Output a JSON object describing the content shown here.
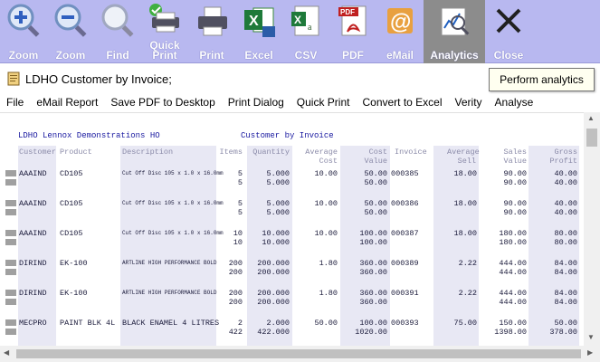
{
  "toolbar": {
    "buttons": [
      {
        "label": "Zoom",
        "icon": "zoom-in-icon"
      },
      {
        "label": "Zoom",
        "icon": "zoom-out-icon"
      },
      {
        "label": "Find",
        "icon": "find-icon"
      },
      {
        "label": "Quick Print",
        "icon": "quick-print-icon"
      },
      {
        "label": "Print",
        "icon": "print-icon"
      },
      {
        "label": "Excel",
        "icon": "excel-icon"
      },
      {
        "label": "CSV",
        "icon": "csv-icon"
      },
      {
        "label": "PDF",
        "icon": "pdf-icon"
      },
      {
        "label": "eMail",
        "icon": "email-icon"
      },
      {
        "label": "Analytics",
        "icon": "analytics-icon"
      },
      {
        "label": "Close",
        "icon": "close-icon"
      }
    ],
    "active": "Analytics"
  },
  "window": {
    "title": "LDHO Customer by Invoice;"
  },
  "tooltip": "Perform analytics",
  "menu": [
    "File",
    "eMail Report",
    "Save PDF to Desktop",
    "Print Dialog",
    "Quick Print",
    "Convert to Excel",
    "Verity",
    "Analyse"
  ],
  "report": {
    "company": "LDHO Lennox Demonstrations HO",
    "name": "Customer by Invoice",
    "columns": [
      "Customer",
      "Product",
      "Description",
      "Items",
      "Quantity",
      "Average Cost",
      "Cost Value",
      "Invoice",
      "Average Sell",
      "Sales Value",
      "Gross Profit"
    ],
    "rows": [
      {
        "customer": "AAAIND",
        "product": "CD105",
        "description": "Cut Off Disc 105 x 1.0 x 16.0mm",
        "items": [
          "5",
          "5"
        ],
        "quantity": [
          "5.000",
          "5.000"
        ],
        "avg_cost": "10.00",
        "cost_value": [
          "50.00",
          "50.00"
        ],
        "invoice": "000385",
        "avg_sell": "18.00",
        "sales_value": [
          "90.00",
          "90.00"
        ],
        "gross_profit": [
          "40.00",
          "40.00"
        ]
      },
      {
        "customer": "AAAIND",
        "product": "CD105",
        "description": "Cut Off Disc 105 x 1.0 x 16.0mm",
        "items": [
          "5",
          "5"
        ],
        "quantity": [
          "5.000",
          "5.000"
        ],
        "avg_cost": "10.00",
        "cost_value": [
          "50.00",
          "50.00"
        ],
        "invoice": "000386",
        "avg_sell": "18.00",
        "sales_value": [
          "90.00",
          "90.00"
        ],
        "gross_profit": [
          "40.00",
          "40.00"
        ]
      },
      {
        "customer": "AAAIND",
        "product": "CD105",
        "description": "Cut Off Disc 105 x 1.0 x 16.0mm",
        "items": [
          "10",
          "10"
        ],
        "quantity": [
          "10.000",
          "10.000"
        ],
        "avg_cost": "10.00",
        "cost_value": [
          "100.00",
          "100.00"
        ],
        "invoice": "000387",
        "avg_sell": "18.00",
        "sales_value": [
          "180.00",
          "180.00"
        ],
        "gross_profit": [
          "80.00",
          "80.00"
        ]
      },
      {
        "customer": "DIRIND",
        "product": "EK-100",
        "description": "ARTLINE HIGH PERFORMANCE BOLD",
        "items": [
          "200",
          "200"
        ],
        "quantity": [
          "200.000",
          "200.000"
        ],
        "avg_cost": "1.80",
        "cost_value": [
          "360.00",
          "360.00"
        ],
        "invoice": "000389",
        "avg_sell": "2.22",
        "sales_value": [
          "444.00",
          "444.00"
        ],
        "gross_profit": [
          "84.00",
          "84.00"
        ]
      },
      {
        "customer": "DIRIND",
        "product": "EK-100",
        "description": "ARTLINE HIGH PERFORMANCE BOLD",
        "items": [
          "200",
          "200"
        ],
        "quantity": [
          "200.000",
          "200.000"
        ],
        "avg_cost": "1.80",
        "cost_value": [
          "360.00",
          "360.00"
        ],
        "invoice": "000391",
        "avg_sell": "2.22",
        "sales_value": [
          "444.00",
          "444.00"
        ],
        "gross_profit": [
          "84.00",
          "84.00"
        ]
      },
      {
        "customer": "MECPRO",
        "product": "PAINT BLK 4L",
        "description": "BLACK ENAMEL 4 LITRES",
        "items": [
          "2",
          "422"
        ],
        "quantity": [
          "2.000",
          "422.000"
        ],
        "avg_cost": "50.00",
        "cost_value": [
          "100.00",
          "1020.00"
        ],
        "invoice": "000393",
        "avg_sell": "75.00",
        "sales_value": [
          "150.00",
          "1398.00"
        ],
        "gross_profit": [
          "50.00",
          "378.00"
        ]
      }
    ]
  }
}
